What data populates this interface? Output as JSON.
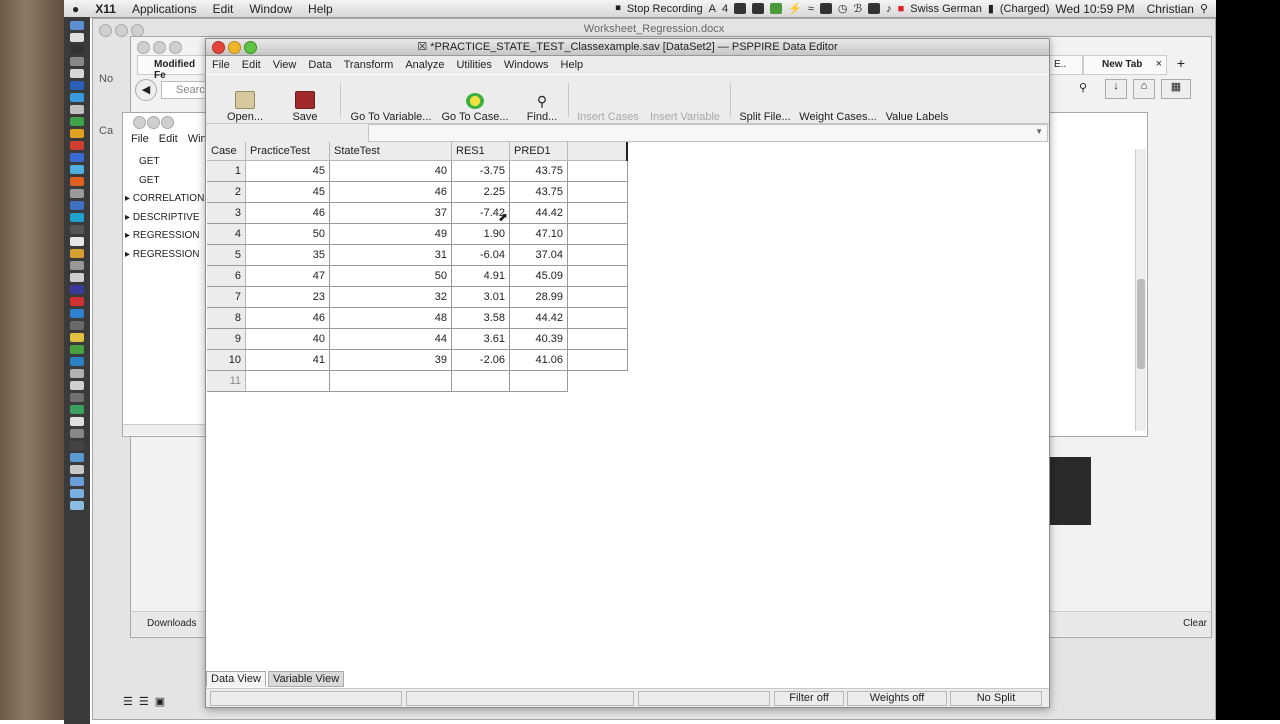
{
  "menubar": {
    "apple": "",
    "items": [
      "X11",
      "Applications",
      "Edit",
      "Window",
      "Help"
    ],
    "stop_recording": "Stop Recording",
    "a4": "4",
    "keyboard": "Swiss German",
    "battery": "(Charged)",
    "clock": "Wed 10:59 PM",
    "user": "Christian"
  },
  "bg_doc_title": "Worksheet_Regression.docx",
  "browser": {
    "tab_left": "Modified Fe",
    "tab_right_a": "E..",
    "tab_new": "New Tab",
    "search_placeholder": "Search",
    "downloads": "Downloads",
    "clear": "Clear",
    "no_label": "No",
    "ca_label": "Ca"
  },
  "output_viewer": {
    "menus": [
      "File",
      "Edit",
      "Win"
    ],
    "items": [
      "GET",
      "GET",
      "CORRELATION",
      "DESCRIPTIVE",
      "REGRESSION",
      "REGRESSION"
    ]
  },
  "pspp": {
    "title": "*PRACTICE_STATE_TEST_Classexample.sav [DataSet2] — PSPPIRE Data Editor",
    "menus": [
      "File",
      "Edit",
      "View",
      "Data",
      "Transform",
      "Analyze",
      "Utilities",
      "Windows",
      "Help"
    ],
    "toolbar": {
      "open": "Open...",
      "save": "Save",
      "goto_variable": "Go To Variable...",
      "goto_case": "Go To Case...",
      "find": "Find...",
      "insert_cases": "Insert Cases",
      "insert_variable": "Insert Variable",
      "split_file": "Split File...",
      "weight_cases": "Weight Cases...",
      "value_labels": "Value Labels"
    },
    "grid": {
      "headers": [
        "Case",
        "PracticeTest",
        "StateTest",
        "RES1",
        "PRED1",
        ""
      ],
      "rows": [
        {
          "case": "1",
          "practice": "45",
          "state": "40",
          "res1": "-3.75",
          "pred1": "43.75"
        },
        {
          "case": "2",
          "practice": "45",
          "state": "46",
          "res1": "2.25",
          "pred1": "43.75"
        },
        {
          "case": "3",
          "practice": "46",
          "state": "37",
          "res1": "-7.42",
          "pred1": "44.42"
        },
        {
          "case": "4",
          "practice": "50",
          "state": "49",
          "res1": "1.90",
          "pred1": "47.10"
        },
        {
          "case": "5",
          "practice": "35",
          "state": "31",
          "res1": "-6.04",
          "pred1": "37.04"
        },
        {
          "case": "6",
          "practice": "47",
          "state": "50",
          "res1": "4.91",
          "pred1": "45.09"
        },
        {
          "case": "7",
          "practice": "23",
          "state": "32",
          "res1": "3.01",
          "pred1": "28.99"
        },
        {
          "case": "8",
          "practice": "46",
          "state": "48",
          "res1": "3.58",
          "pred1": "44.42"
        },
        {
          "case": "9",
          "practice": "40",
          "state": "44",
          "res1": "3.61",
          "pred1": "40.39"
        },
        {
          "case": "10",
          "practice": "41",
          "state": "39",
          "res1": "-2.06",
          "pred1": "41.06"
        }
      ],
      "empty_case": "11"
    },
    "tabs": {
      "data_view": "Data View",
      "variable_view": "Variable View"
    },
    "status": {
      "filter": "Filter off",
      "weights": "Weights off",
      "split": "No Split"
    }
  },
  "colors": {
    "accent_red": "#e4453a",
    "accent_yellow": "#f0b62b",
    "accent_green": "#5ec446"
  }
}
